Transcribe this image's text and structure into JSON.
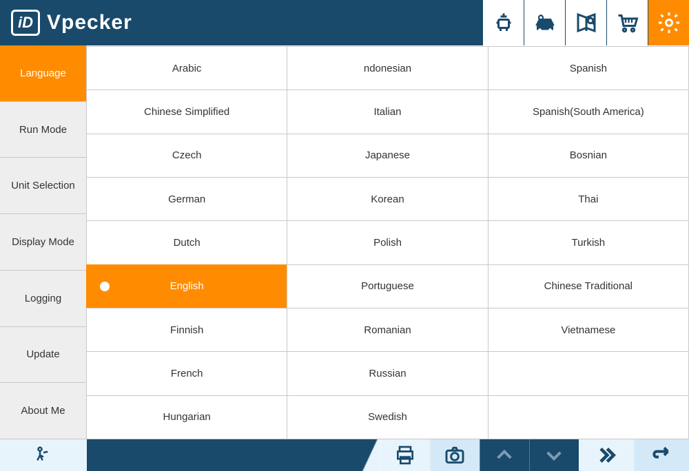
{
  "brand": "Vpecker",
  "sidebar": [
    {
      "label": "Language",
      "active": true
    },
    {
      "label": "Run Mode",
      "active": false
    },
    {
      "label": "Unit Selection",
      "active": false
    },
    {
      "label": "Display Mode",
      "active": false
    },
    {
      "label": "Logging",
      "active": false
    },
    {
      "label": "Update",
      "active": false
    },
    {
      "label": "About Me",
      "active": false
    }
  ],
  "languages": {
    "columns": 3,
    "rows": 9,
    "cells": [
      [
        "Arabic",
        "ndonesian",
        "Spanish"
      ],
      [
        "Chinese Simplified",
        "Italian",
        "Spanish(South America)"
      ],
      [
        "Czech",
        "Japanese",
        "Bosnian"
      ],
      [
        "German",
        "Korean",
        "Thai"
      ],
      [
        "Dutch",
        "Polish",
        "Turkish"
      ],
      [
        "English",
        "Portuguese",
        "Chinese Traditional"
      ],
      [
        "Finnish",
        "Romanian",
        "Vietnamese"
      ],
      [
        "French",
        "Russian",
        ""
      ],
      [
        "Hungarian",
        "Swedish",
        ""
      ]
    ],
    "selected": "English"
  },
  "header_icons": [
    "diagnostic-icon",
    "vehicle-icon",
    "manual-icon",
    "cart-icon",
    "settings-icon"
  ],
  "header_active": "settings-icon",
  "footer_icons": [
    "exit-icon",
    "print-icon",
    "camera-icon",
    "up-icon",
    "down-icon",
    "forward-icon",
    "back-icon"
  ]
}
